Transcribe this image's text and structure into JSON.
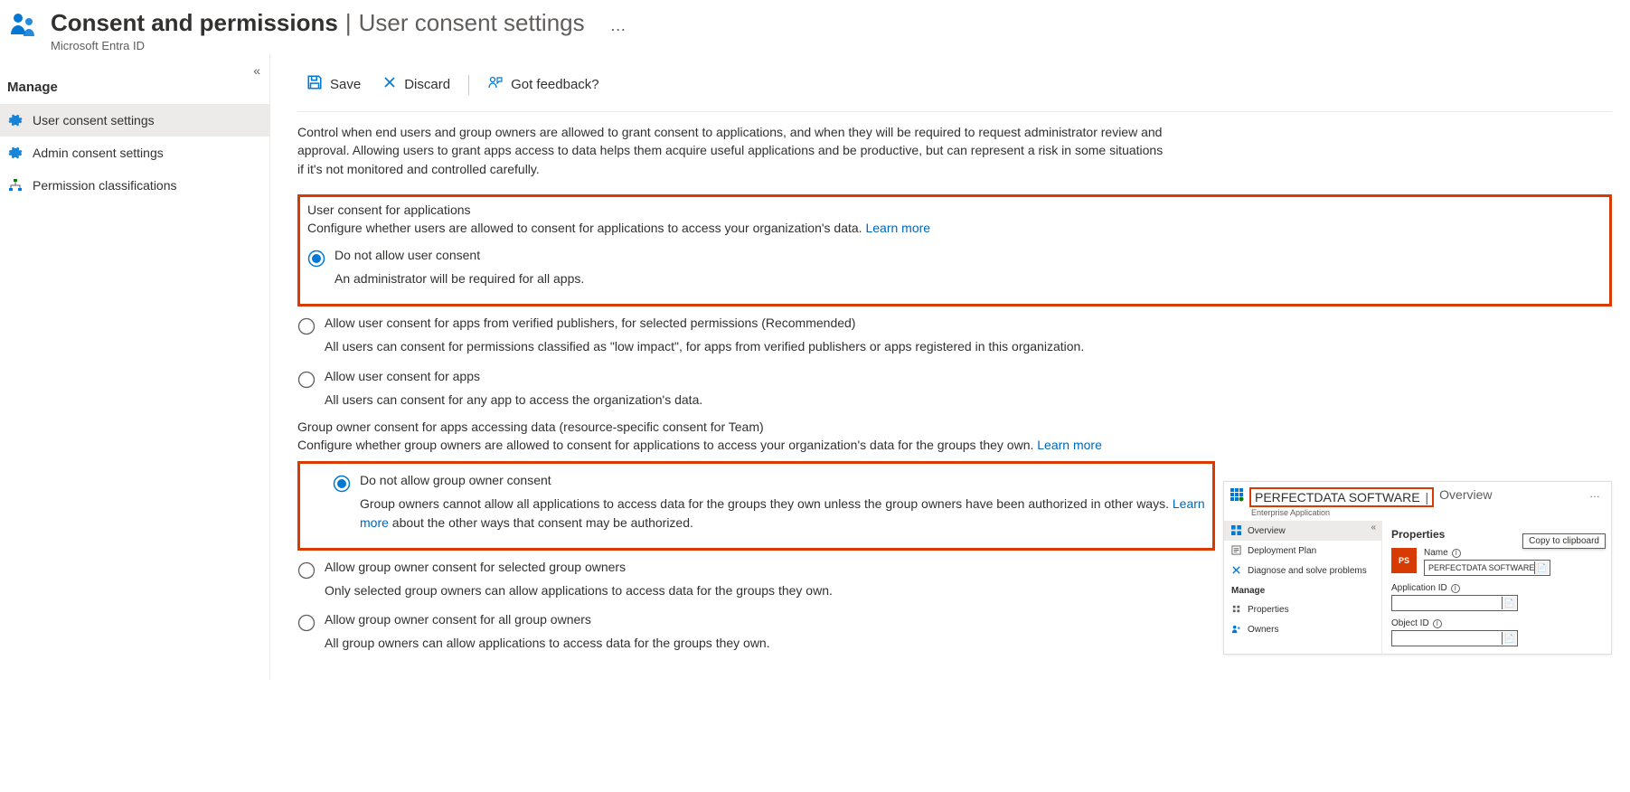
{
  "header": {
    "main_title": "Consent and permissions",
    "sub_title": "User consent settings",
    "tenant": "Microsoft Entra ID",
    "ellipsis": "…"
  },
  "sidebar": {
    "section_label": "Manage",
    "items": [
      {
        "label": "User consent settings",
        "selected": true,
        "icon": "gear"
      },
      {
        "label": "Admin consent settings",
        "selected": false,
        "icon": "gear"
      },
      {
        "label": "Permission classifications",
        "selected": false,
        "icon": "hierarchy"
      }
    ],
    "collapse_hint": "«"
  },
  "toolbar": {
    "save_label": "Save",
    "discard_label": "Discard",
    "feedback_label": "Got feedback?"
  },
  "intro": "Control when end users and group owners are allowed to grant consent to applications, and when they will be required to request administrator review and approval. Allowing users to grant apps access to data helps them acquire useful applications and be productive, but can represent a risk in some situations if it's not monitored and controlled carefully.",
  "user_consent": {
    "title": "User consent for applications",
    "desc": "Configure whether users are allowed to consent for applications to access your organization's data. ",
    "learn_more": "Learn more",
    "options": [
      {
        "label": "Do not allow user consent",
        "sub": "An administrator will be required for all apps.",
        "selected": true
      },
      {
        "label": "Allow user consent for apps from verified publishers, for selected permissions (Recommended)",
        "sub": "All users can consent for permissions classified as \"low impact\", for apps from verified publishers or apps registered in this organization.",
        "selected": false
      },
      {
        "label": "Allow user consent for apps",
        "sub": "All users can consent for any app to access the organization's data.",
        "selected": false
      }
    ]
  },
  "group_consent": {
    "title": "Group owner consent for apps accessing data (resource-specific consent for Team)",
    "desc": "Configure whether group owners are allowed to consent for applications to access your organization's data for the groups they own. ",
    "learn_more": "Learn more",
    "options": [
      {
        "label": "Do not allow group owner consent",
        "sub_pre": "Group owners cannot allow all applications to access data for the groups they own unless the group owners have been authorized in other ways. ",
        "sub_link": "Learn more",
        "sub_post": " about the other ways that consent may be authorized.",
        "selected": true
      },
      {
        "label": "Allow group owner consent for selected group owners",
        "sub_pre": "Only selected group owners can allow applications to access data for the groups they own.",
        "sub_link": "",
        "sub_post": "",
        "selected": false
      },
      {
        "label": "Allow group owner consent for all group owners",
        "sub_pre": "All group owners can allow applications to access data for the groups they own.",
        "sub_link": "",
        "sub_post": "",
        "selected": false
      }
    ]
  },
  "mini": {
    "title_main": "PERFECTDATA SOFTWARE",
    "title_sub": "Overview",
    "tenant": "Enterprise Application",
    "ellipsis": "…",
    "collapse": "«",
    "nav": {
      "top": [
        {
          "label": "Overview",
          "selected": true,
          "icon": "grid"
        },
        {
          "label": "Deployment Plan",
          "selected": false,
          "icon": "plan"
        },
        {
          "label": "Diagnose and solve problems",
          "selected": false,
          "icon": "diagnose"
        }
      ],
      "section": "Manage",
      "bottom": [
        {
          "label": "Properties",
          "selected": false,
          "icon": "properties"
        },
        {
          "label": "Owners",
          "selected": false,
          "icon": "owners"
        }
      ]
    },
    "props": {
      "header": "Properties",
      "avatar": "PS",
      "tooltip": "Copy to clipboard",
      "fields": [
        {
          "label": "Name",
          "value": "PERFECTDATA SOFTWARE"
        },
        {
          "label": "Application ID",
          "value": ""
        },
        {
          "label": "Object ID",
          "value": ""
        }
      ]
    }
  }
}
